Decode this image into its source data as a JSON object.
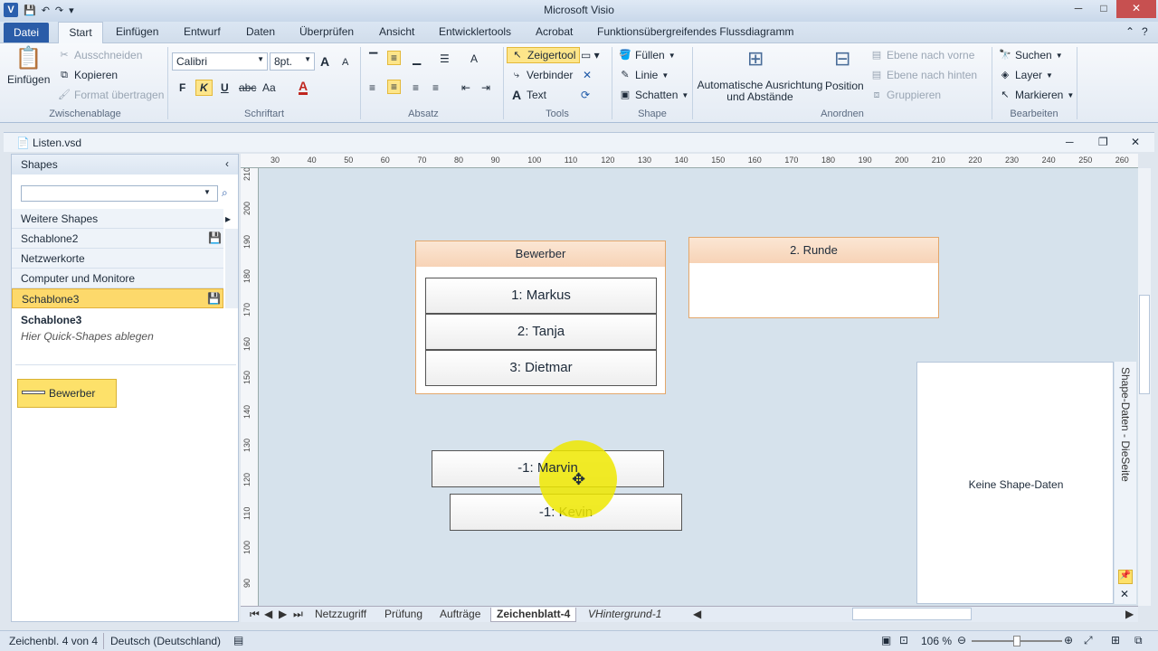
{
  "app": {
    "title": "Microsoft Visio"
  },
  "tabs": {
    "file": "Datei",
    "items": [
      "Start",
      "Einfügen",
      "Entwurf",
      "Daten",
      "Überprüfen",
      "Ansicht",
      "Entwicklertools",
      "Acrobat",
      "Funktionsübergreifendes Flussdiagramm"
    ]
  },
  "ribbon": {
    "clipboard": {
      "paste": "Einfügen",
      "cut": "Ausschneiden",
      "copy": "Kopieren",
      "format_painter": "Format übertragen",
      "label": "Zwischenablage"
    },
    "font": {
      "name": "Calibri",
      "size": "8pt.",
      "bold": "F",
      "italic": "K",
      "underline": "U",
      "strike": "abc",
      "case": "Aa",
      "color": "A",
      "grow": "A",
      "shrink": "A",
      "label": "Schriftart"
    },
    "paragraph": {
      "label": "Absatz"
    },
    "tools": {
      "pointer": "Zeigertool",
      "connector": "Verbinder",
      "text": "Text",
      "label": "Tools"
    },
    "shape": {
      "fill": "Füllen",
      "line": "Linie",
      "shadow": "Schatten",
      "label": "Shape"
    },
    "arrange": {
      "auto_align": "Automatische Ausrichtung und Abstände",
      "position": "Position",
      "bring_forward": "Ebene nach vorne",
      "send_backward": "Ebene nach hinten",
      "group": "Gruppieren",
      "label": "Anordnen"
    },
    "editing": {
      "find": "Suchen",
      "layer": "Layer",
      "select": "Markieren",
      "label": "Bearbeiten"
    }
  },
  "document": {
    "name": "Listen.vsd"
  },
  "shapes_panel": {
    "header": "Shapes",
    "search_placeholder": "",
    "stencils": [
      "Weitere Shapes",
      "Schablone2",
      "Netzwerkorte",
      "Computer und Monitore",
      "Schablone3"
    ],
    "selected_title": "Schablone3",
    "hint": "Hier Quick-Shapes ablegen",
    "master": "Bewerber"
  },
  "ruler": {
    "h_ticks": [
      "30",
      "40",
      "50",
      "60",
      "70",
      "80",
      "90",
      "100",
      "110",
      "120",
      "130",
      "140",
      "150",
      "160",
      "170",
      "180",
      "190",
      "200",
      "210",
      "220",
      "230",
      "240",
      "250",
      "260"
    ],
    "v_ticks": [
      "210",
      "200",
      "190",
      "180",
      "170",
      "160",
      "150",
      "140",
      "130",
      "120",
      "110",
      "100",
      "90"
    ]
  },
  "canvas": {
    "container1": {
      "title": "Bewerber",
      "items": [
        "1: Markus",
        "2: Tanja",
        "3: Dietmar"
      ]
    },
    "container2": {
      "title": "2. Runde"
    },
    "loose_items": [
      "-1: Marvin",
      "-1: Kevin"
    ]
  },
  "shape_data": {
    "title": "Shape-Daten - DieSeite",
    "empty": "Keine Shape-Daten"
  },
  "page_tabs": [
    "Netzzugriff",
    "Prüfung",
    "Aufträge",
    "Zeichenblatt-4",
    "VHintergrund-1"
  ],
  "status": {
    "page": "Zeichenbl. 4 von 4",
    "language": "Deutsch (Deutschland)",
    "zoom": "106 %"
  }
}
